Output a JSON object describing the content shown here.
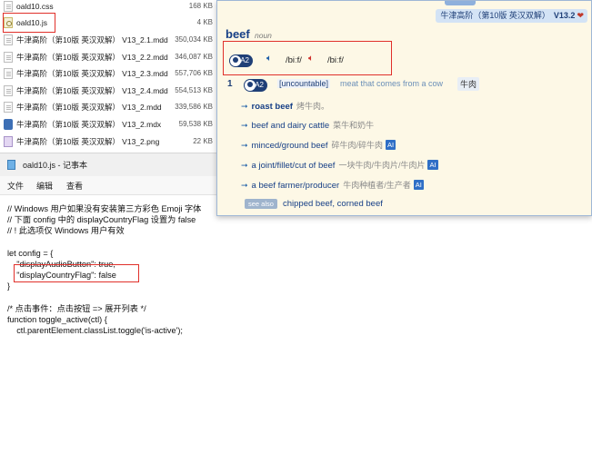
{
  "files": [
    {
      "name": "oald10.css",
      "size": "168 KB",
      "icon": "document-icon"
    },
    {
      "name": "oald10.js",
      "size": "4 KB",
      "icon": "js-file-icon"
    },
    {
      "name": "牛津高阶（第10版 英汉双解） V13_2.1.mdd",
      "size": "350,034 KB",
      "icon": "document-icon"
    },
    {
      "name": "牛津高阶（第10版 英汉双解） V13_2.2.mdd",
      "size": "346,087 KB",
      "icon": "document-icon"
    },
    {
      "name": "牛津高阶（第10版 英汉双解） V13_2.3.mdd",
      "size": "557,706 KB",
      "icon": "document-icon"
    },
    {
      "name": "牛津高阶（第10版 英汉双解） V13_2.4.mdd",
      "size": "554,513 KB",
      "icon": "document-icon"
    },
    {
      "name": "牛津高阶（第10版 英汉双解） V13_2.mdd",
      "size": "339,586 KB",
      "icon": "document-icon"
    },
    {
      "name": "牛津高阶（第10版 英汉双解） V13_2.mdx",
      "size": "59,538 KB",
      "icon": "mdx-file-icon"
    },
    {
      "name": "牛津高阶（第10版 英汉双解） V13_2.png",
      "size": "22 KB",
      "icon": "image-file-icon"
    }
  ],
  "notepad": {
    "title": "oald10.js - 记事本",
    "menu": [
      "文件",
      "编辑",
      "查看"
    ],
    "lines": [
      "// Windows 用户如果没有安装第三方彩色 Emoji 字体",
      "// 下面 config 中的 displayCountryFlag 设置为 false",
      "// ! 此选项仅 Windows 用户有效",
      "",
      "let config = {",
      "    \"displayAudioButton\": true,",
      "    \"displayCountryFlag\": false",
      "}",
      "",
      "/* 点击事件：点击按钮 => 展开列表 */",
      "function toggle_active(ctl) {",
      "    ctl.parentElement.classList.toggle('is-active');"
    ]
  },
  "popup": {
    "dict_name": "牛津高阶（第10版 英汉双解）",
    "version": "V13.2",
    "headword": "beef",
    "pos": "noun",
    "level": "A2",
    "pron_uk": "/biːf/",
    "pron_us": "/biːf/",
    "sense": {
      "number": "1",
      "level": "A2",
      "grammar": "[uncountable]",
      "definition_en": "meat that comes from a cow",
      "definition_zh": "牛肉"
    },
    "collocations": [
      {
        "en": "roast beef",
        "zh": "烤牛肉。",
        "ai": false
      },
      {
        "en": "beef and dairy cattle",
        "zh": "菜牛和奶牛",
        "ai": false
      },
      {
        "en": "minced/ground beef",
        "zh": "碎牛肉/碎牛肉",
        "ai": true
      },
      {
        "en": "a joint/fillet/cut of beef",
        "zh": "一块牛肉/牛肉片/牛肉片",
        "ai": true
      },
      {
        "en": "a beef farmer/producer",
        "zh": "牛肉种植者/生产者",
        "ai": true
      }
    ],
    "ai_label": "AI",
    "see_also_label": "see also",
    "see_also": "chipped beef, corned beef"
  },
  "colors": {
    "highlight": "#e0302a",
    "popup_bg": "#fdf8e6",
    "link_blue": "#163f86",
    "speaker_uk": "#1f5fa8",
    "speaker_us": "#d0312d"
  }
}
